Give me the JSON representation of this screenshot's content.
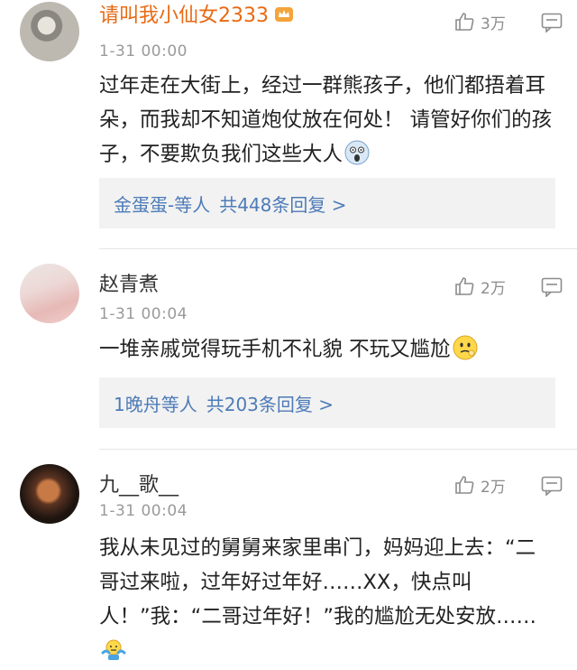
{
  "comments": [
    {
      "username": "请叫我小仙女2333",
      "timestamp": "1-31 00:00",
      "likes": "3万",
      "text": "过年走在大街上，经过一群熊孩子，他们都捂着耳朵，而我却不知道炮仗放在何处！ 请管好你们的孩子，不要欺负我们这些大人",
      "replies_users": "金蛋蛋-等人",
      "replies_count": "共448条回复 >"
    },
    {
      "username": "赵青煮",
      "timestamp": "1-31 00:04",
      "likes": "2万",
      "text": "一堆亲戚觉得玩手机不礼貌 不玩又尴尬",
      "replies_users": "1晚舟等人",
      "replies_count": "共203条回复 >"
    },
    {
      "username": "九__歌__",
      "timestamp": "1-31 00:04",
      "likes": "2万",
      "text": "我从未见过的舅舅来家里串门，妈妈迎上去：“二哥过来啦，过年好过年好……XX，快点叫人！”我：“二哥过年好！”我的尴尬无处安放……"
    }
  ],
  "colors": {
    "vip_name": "#e86a13",
    "link": "#4d7bb8",
    "meta": "#9a9a9a"
  },
  "icons": [
    "thumbs-up-icon",
    "reply-icon",
    "vip-crown-icon",
    "scared-emoji-icon",
    "awkward-emoji-icon",
    "shrug-emoji-icon"
  ]
}
